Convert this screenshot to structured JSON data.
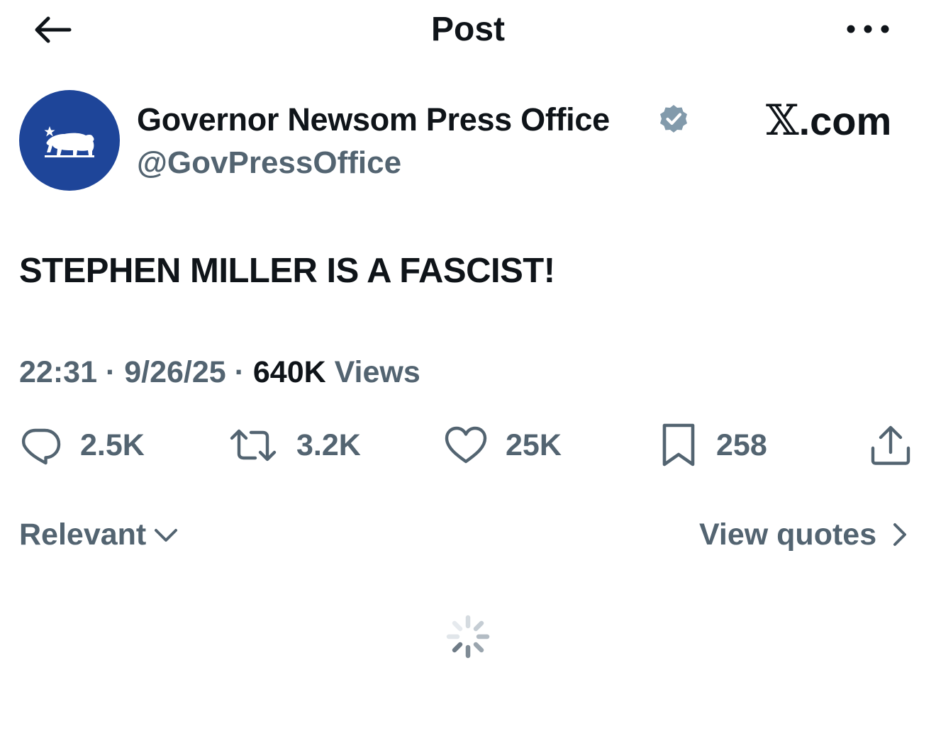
{
  "header": {
    "title": "Post",
    "back_icon": "arrow-left-icon",
    "more_icon": "more-dots-icon"
  },
  "author": {
    "name": "Governor Newsom Press Office",
    "handle": "@GovPressOffice",
    "verified": true,
    "avatar_color": "#1e4599",
    "avatar_icon": "california-bear-icon"
  },
  "source_logo": {
    "glyph": "𝕏",
    "text": ".com"
  },
  "post": {
    "text": "STEPHEN MILLER IS A FASCIST!"
  },
  "meta": {
    "time": "22:31",
    "separator1": " · ",
    "date": "9/26/25",
    "separator2": " · ",
    "views_count": "640K",
    "views_label": " Views"
  },
  "actions": {
    "reply": {
      "icon": "reply-icon",
      "count": "2.5K"
    },
    "repost": {
      "icon": "repost-icon",
      "count": "3.2K"
    },
    "like": {
      "icon": "heart-icon",
      "count": "25K"
    },
    "bookmark": {
      "icon": "bookmark-icon",
      "count": "258"
    },
    "share": {
      "icon": "share-icon"
    }
  },
  "filters": {
    "sort_label": "Relevant",
    "view_quotes_label": "View quotes"
  },
  "colors": {
    "text_primary": "#0f1419",
    "text_secondary": "#536471",
    "verified_badge": "#829aab",
    "avatar_bg": "#1e4599"
  }
}
